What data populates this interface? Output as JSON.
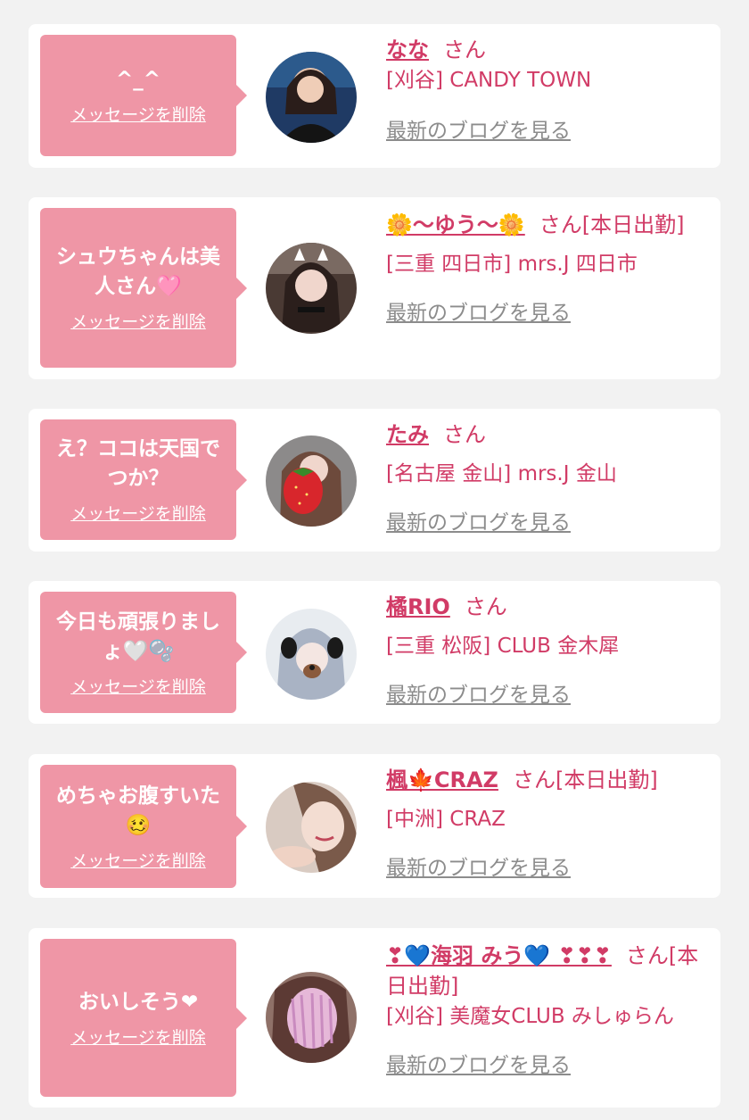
{
  "favorites": [
    {
      "message": "^_^",
      "delete_label": "メッセージを削除",
      "name": "なな",
      "suffix": "さん",
      "shop": "[刈谷] CANDY TOWN",
      "blog_label": "最新のブログを見る"
    },
    {
      "message": "シュウちゃんは美人さん🩷",
      "delete_label": "メッセージを削除",
      "name": "🌼〜ゆう〜🌼",
      "suffix": "さん[本日出勤]",
      "shop": "[三重 四日市] mrs.J 四日市",
      "blog_label": "最新のブログを見る"
    },
    {
      "message": "え？ココは天国でつか？",
      "delete_label": "メッセージを削除",
      "name": "たみ",
      "suffix": "さん",
      "shop": "[名古屋 金山] mrs.J 金山",
      "blog_label": "最新のブログを見る"
    },
    {
      "message": "今日も頑張りましょ🤍🫧",
      "delete_label": "メッセージを削除",
      "name": "橘RIO",
      "suffix": "さん",
      "shop": "[三重 松阪] CLUB 金木犀",
      "blog_label": "最新のブログを見る"
    },
    {
      "message": "めちゃお腹すいた🥴",
      "delete_label": "メッセージを削除",
      "name": "楓🍁CRAZ",
      "suffix": "さん[本日出勤]",
      "shop": "[中洲] CRAZ",
      "blog_label": "最新のブログを見る"
    },
    {
      "message": "おいしそう❤",
      "delete_label": "メッセージを削除",
      "name": "❣💙海羽 みう💙 ❣❣❣",
      "suffix": "さん[本日出勤]",
      "shop": "[刈谷] 美魔女CLUB みしゅらん",
      "blog_label": "最新のブログを見る"
    }
  ]
}
